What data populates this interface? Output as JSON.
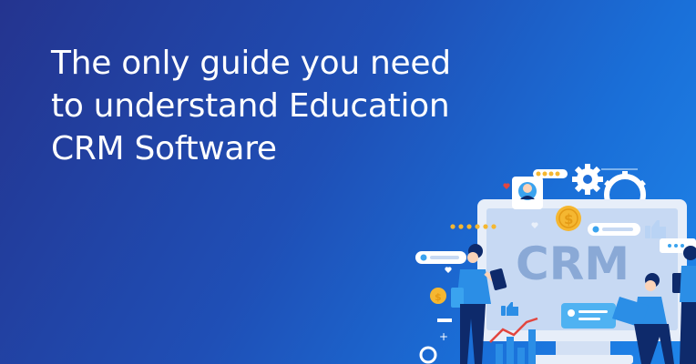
{
  "headline": {
    "lines": [
      "The only guide you need",
      "to understand Education",
      "CRM Software"
    ]
  },
  "illustration": {
    "monitor_text": "CRM",
    "currency_symbol": "$",
    "icons": [
      "gear-icon",
      "star-rating-icon",
      "heart-icon",
      "thumbs-up-icon",
      "dollar-coin-icon",
      "chat-bubble-icon",
      "avatar-icon",
      "bar-chart-icon",
      "line-chart-icon"
    ]
  },
  "colors": {
    "background_start": "#24348f",
    "background_end": "#1f86ea",
    "monitor_frame": "#e7eef9",
    "monitor_screen": "#c7d9f3",
    "crm_text": "#8aa9d6",
    "coin": "#f5b731",
    "accent_red": "#e2463f",
    "person_shirt": "#2b8ee6",
    "person_dark": "#0e2a6b"
  }
}
